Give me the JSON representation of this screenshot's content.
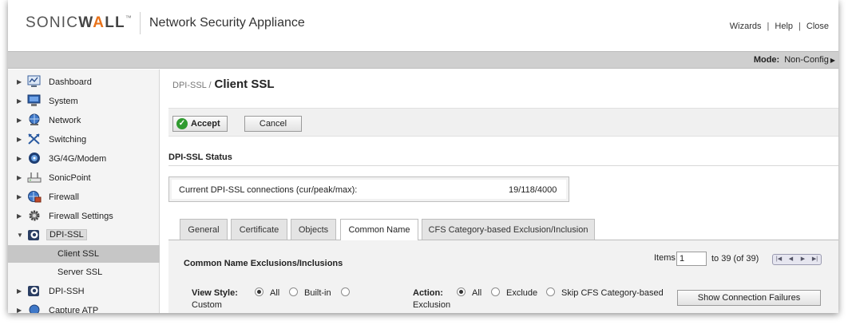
{
  "header": {
    "logo": "SONICWALL",
    "app_title": "Network Security Appliance",
    "links": [
      "Wizards",
      "Help",
      "Close"
    ],
    "link_separator": "|"
  },
  "modebar": {
    "label": "Mode:",
    "value": "Non-Config"
  },
  "sidebar": {
    "items": [
      {
        "label": "Dashboard",
        "icon": "dashboard-icon"
      },
      {
        "label": "System",
        "icon": "monitor-icon"
      },
      {
        "label": "Network",
        "icon": "network-globe-icon"
      },
      {
        "label": "Switching",
        "icon": "switching-arrows-icon"
      },
      {
        "label": "3G/4G/Modem",
        "icon": "modem-icon"
      },
      {
        "label": "SonicPoint",
        "icon": "access-point-icon"
      },
      {
        "label": "Firewall",
        "icon": "firewall-icon"
      },
      {
        "label": "Firewall Settings",
        "icon": "settings-gear-icon"
      },
      {
        "label": "DPI-SSL",
        "icon": "dpi-ssl-icon"
      },
      {
        "label": "DPI-SSH",
        "icon": "dpi-ssh-icon"
      },
      {
        "label": "Capture ATP",
        "icon": "capture-atp-icon"
      }
    ],
    "subitems": [
      {
        "label": "Client SSL"
      },
      {
        "label": "Server SSL"
      }
    ]
  },
  "main": {
    "breadcrumb_parent": "DPI-SSL /",
    "page_title": "Client SSL",
    "accept_label": "Accept",
    "cancel_label": "Cancel",
    "status_section_title": "DPI-SSL Status",
    "status_label": "Current DPI-SSL connections (cur/peak/max):",
    "status_value": "19/118/4000",
    "tabs": [
      "General",
      "Certificate",
      "Objects",
      "Common Name",
      "CFS Category-based Exclusion/Inclusion"
    ],
    "active_tab": "Common Name",
    "cn_title": "Common Name Exclusions/Inclusions",
    "pager_items_label": "Items",
    "pager_items_value": "1",
    "pager_range": "to 39 (of 39)",
    "view_style_label": "View Style:",
    "view_all": "All",
    "view_builtin": "Built-in",
    "view_custom": "Custom",
    "action_label": "Action:",
    "action_all": "All",
    "action_exclude": "Exclude",
    "action_skip": "Skip CFS Category-based",
    "action_exclusion": "Exclusion",
    "show_failures_label": "Show Connection Failures"
  }
}
